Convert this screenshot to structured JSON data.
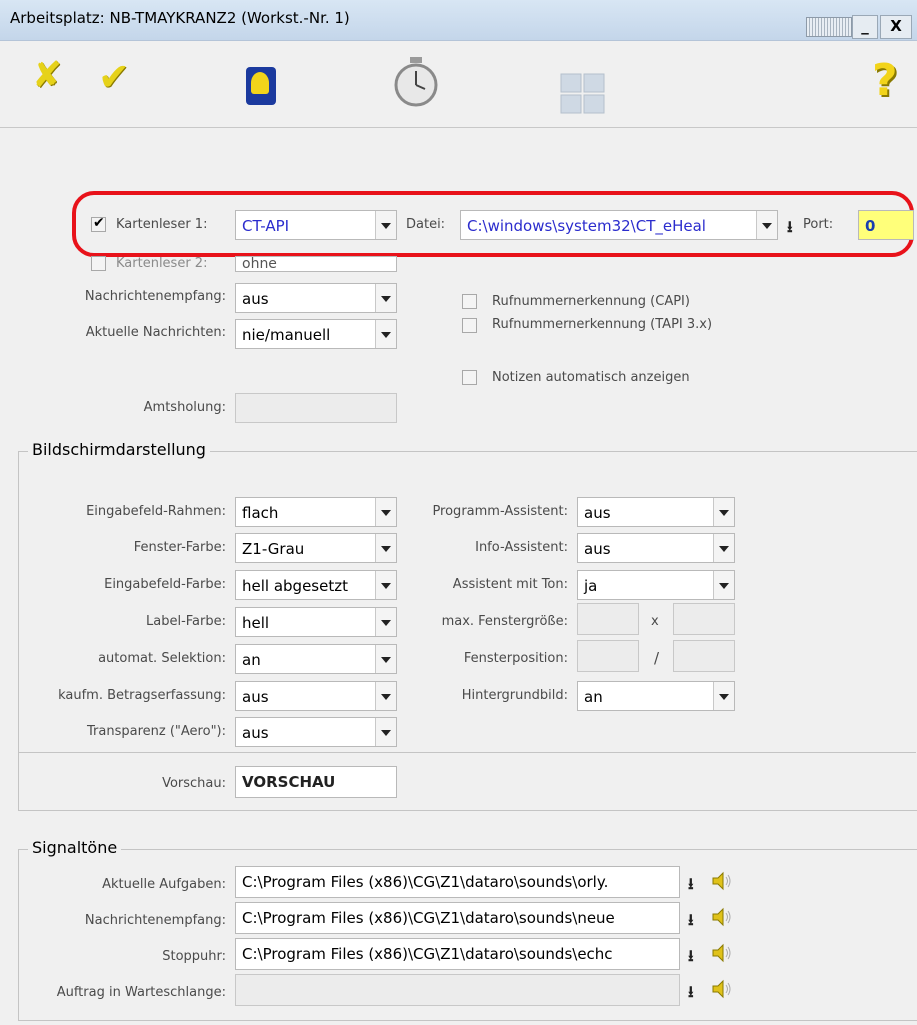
{
  "window": {
    "title": "Arbeitsplatz: NB-TMAYKRANZ2 (Workst.-Nr.  1)",
    "minimize_label": "_",
    "close_label": "X"
  },
  "toolbar": {
    "icons": [
      "cancel-x-icon",
      "ok-check-icon",
      "help-book-icon",
      "stopwatch-icon",
      "grid-icon",
      "help-question-icon"
    ],
    "cancel_glyph": "✘",
    "ok_glyph": "✔",
    "help_glyph": "?"
  },
  "colors": {
    "highlight_red": "#e8121a",
    "field_text_blue": "#2b2ccd",
    "port_yellow": "#ffff7a"
  },
  "general": {
    "kartenleser1": {
      "label": "Kartenleser 1:",
      "checked": true,
      "value": "CT-API"
    },
    "datei": {
      "label": "Datei:",
      "value": "C:\\windows\\system32\\CT_eHeal"
    },
    "port": {
      "label": "Port:",
      "value": "0"
    },
    "kartenleser2": {
      "label": "Kartenleser 2:",
      "checked": false,
      "value": "ohne"
    },
    "nachrichtenempfang": {
      "label": "Nachrichtenempfang:",
      "value": "aus"
    },
    "aktuelle_nachrichten": {
      "label": "Aktuelle Nachrichten:",
      "value": "nie/manuell"
    },
    "rufnummer_capi": {
      "label": "Rufnummernerkennung (CAPI)",
      "checked": false
    },
    "rufnummer_tapi": {
      "label": "Rufnummernerkennung (TAPI 3.x)",
      "checked": false
    },
    "notizen": {
      "label": "Notizen automatisch anzeigen",
      "checked": false
    },
    "amtsholung": {
      "label": "Amtsholung:",
      "value": ""
    }
  },
  "bildschirm": {
    "title": "Bildschirmdarstellung",
    "eingabefeld_rahmen": {
      "label": "Eingabefeld-Rahmen:",
      "value": "flach"
    },
    "fenster_farbe": {
      "label": "Fenster-Farbe:",
      "value": "Z1-Grau"
    },
    "eingabefeld_farbe": {
      "label": "Eingabefeld-Farbe:",
      "value": "hell abgesetzt"
    },
    "label_farbe": {
      "label": "Label-Farbe:",
      "value": "hell"
    },
    "automat_selektion": {
      "label": "automat. Selektion:",
      "value": "an"
    },
    "kaufm_betrag": {
      "label": "kaufm. Betragserfassung:",
      "value": "aus"
    },
    "transparenz": {
      "label": "Transparenz (\"Aero\"):",
      "value": "aus"
    },
    "programm_assistent": {
      "label": "Programm-Assistent:",
      "value": "aus"
    },
    "info_assistent": {
      "label": "Info-Assistent:",
      "value": "aus"
    },
    "assistent_ton": {
      "label": "Assistent mit Ton:",
      "value": "ja"
    },
    "max_fenstergroesse": {
      "label": "max. Fenstergröße:",
      "sep": "x",
      "w": "",
      "h": ""
    },
    "fensterposition": {
      "label": "Fensterposition:",
      "sep": "/",
      "x": "",
      "y": ""
    },
    "hintergrundbild": {
      "label": "Hintergrundbild:",
      "value": "an"
    },
    "vorschau": {
      "label": "Vorschau:",
      "value": "VORSCHAU"
    }
  },
  "signaltoene": {
    "title": "Signaltöne",
    "rows": [
      {
        "label": "Aktuelle Aufgaben:",
        "value": "C:\\Program Files (x86)\\CG\\Z1\\dataro\\sounds\\orly."
      },
      {
        "label": "Nachrichtenempfang:",
        "value": "C:\\Program Files (x86)\\CG\\Z1\\dataro\\sounds\\neue"
      },
      {
        "label": "Stoppuhr:",
        "value": "C:\\Program Files (x86)\\CG\\Z1\\dataro\\sounds\\echc"
      },
      {
        "label": "Auftrag in Warteschlange:",
        "value": ""
      }
    ],
    "download_glyph": "⭳"
  }
}
